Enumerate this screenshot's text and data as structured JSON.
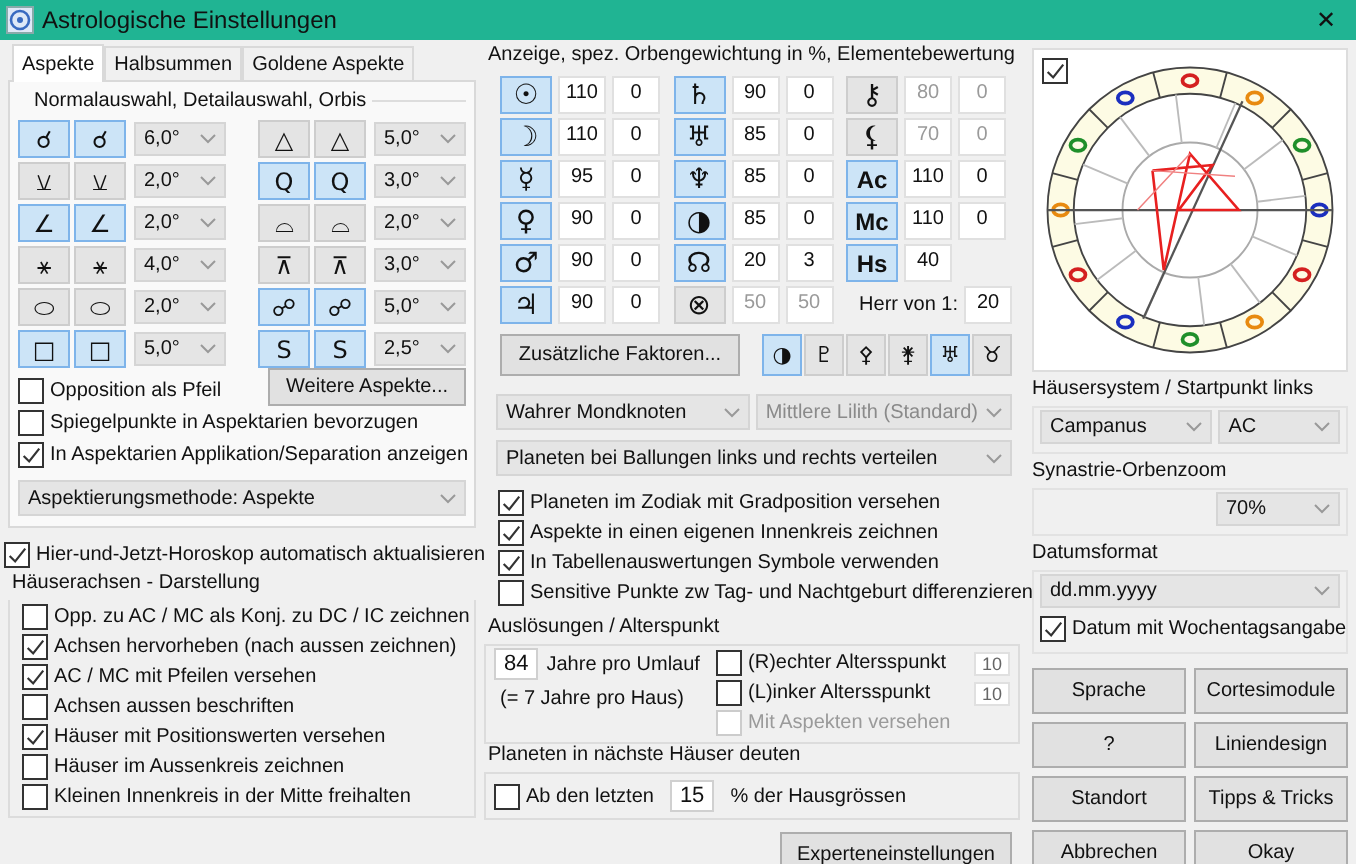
{
  "window": {
    "title": "Astrologische Einstellungen",
    "close": "✕"
  },
  "tabs": [
    {
      "label": "Aspekte",
      "selected": true
    },
    {
      "label": "Halbsummen",
      "selected": false
    },
    {
      "label": "Goldene Aspekte",
      "selected": false
    }
  ],
  "aspects": {
    "heading": "Normalauswahl, Detailauswahl, Orbis",
    "columns": [
      [
        {
          "buttons": [
            {
              "symbol": "☌",
              "selected": true
            },
            {
              "symbol": "☌",
              "selected": true
            }
          ],
          "orb": "6,0°"
        },
        {
          "buttons": [
            {
              "symbol": "⚺",
              "selected": false
            },
            {
              "symbol": "⚺",
              "selected": false
            }
          ],
          "orb": "2,0°"
        },
        {
          "buttons": [
            {
              "symbol": "∠",
              "selected": true
            },
            {
              "symbol": "∠",
              "selected": true
            }
          ],
          "orb": "2,0°"
        },
        {
          "buttons": [
            {
              "symbol": "⚹",
              "selected": false
            },
            {
              "symbol": "⚹",
              "selected": false
            }
          ],
          "orb": "4,0°"
        },
        {
          "buttons": [
            {
              "symbol": "⬭",
              "selected": false
            },
            {
              "symbol": "⬭",
              "selected": false
            }
          ],
          "orb": "2,0°"
        },
        {
          "buttons": [
            {
              "symbol": "□",
              "selected": true
            },
            {
              "symbol": "□",
              "selected": true
            }
          ],
          "orb": "5,0°"
        }
      ],
      [
        {
          "buttons": [
            {
              "symbol": "△",
              "selected": false
            },
            {
              "symbol": "△",
              "selected": false
            }
          ],
          "orb": "5,0°"
        },
        {
          "buttons": [
            {
              "symbol": "Q",
              "selected": true
            },
            {
              "symbol": "Q",
              "selected": true
            }
          ],
          "orb": "3,0°"
        },
        {
          "buttons": [
            {
              "symbol": "⌓",
              "selected": false
            },
            {
              "symbol": "⌓",
              "selected": false
            }
          ],
          "orb": "2,0°"
        },
        {
          "buttons": [
            {
              "symbol": "⊼",
              "selected": false
            },
            {
              "symbol": "⊼",
              "selected": false
            }
          ],
          "orb": "3,0°"
        },
        {
          "buttons": [
            {
              "symbol": "☍",
              "selected": true
            },
            {
              "symbol": "☍",
              "selected": true
            }
          ],
          "orb": "5,0°"
        },
        {
          "buttons": [
            {
              "symbol": "S",
              "selected": true
            },
            {
              "symbol": "S",
              "selected": true
            }
          ],
          "orb": "2,5°"
        }
      ]
    ]
  },
  "more_aspects_button": "Weitere Aspekte...",
  "aspect_options": [
    {
      "label": "Opposition als Pfeil",
      "checked": false
    },
    {
      "label": "Spiegelpunkte in Aspektarien bevorzugen",
      "checked": false
    },
    {
      "label": "In Aspektarien Applikation/Separation anzeigen",
      "checked": true
    }
  ],
  "method_dropdown": "Aspektierungsmethode: Aspekte",
  "auto_update": {
    "label": "Hier-und-Jetzt-Horoskop automatisch aktualisieren",
    "checked": true
  },
  "house_axes": {
    "title": "Häuserachsen - Darstellung",
    "options": [
      {
        "label": "Opp. zu  AC / MC als Konj. zu DC / IC zeichnen",
        "checked": false
      },
      {
        "label": "Achsen hervorheben (nach aussen zeichnen)",
        "checked": true
      },
      {
        "label": "AC / MC mit Pfeilen versehen",
        "checked": true
      },
      {
        "label": "Achsen aussen beschriften",
        "checked": false
      },
      {
        "label": "Häuser mit Positionswerten versehen",
        "checked": true
      },
      {
        "label": "Häuser im Aussenkreis zeichnen",
        "checked": false
      },
      {
        "label": "Kleinen Innenkreis in der Mitte freihalten",
        "checked": false
      }
    ]
  },
  "display": {
    "title": "Anzeige, spez. Orbengewichtung in %, Elementebewertung",
    "columns": [
      [
        {
          "symbol": "☉",
          "selected": true,
          "disabled": false,
          "weight": "110",
          "element": "0"
        },
        {
          "symbol": "☽",
          "selected": true,
          "disabled": false,
          "weight": "110",
          "element": "0"
        },
        {
          "symbol": "☿",
          "selected": true,
          "disabled": false,
          "weight": "95",
          "element": "0"
        },
        {
          "symbol": "♀",
          "selected": true,
          "disabled": false,
          "weight": "90",
          "element": "0"
        },
        {
          "symbol": "♂",
          "selected": true,
          "disabled": false,
          "weight": "90",
          "element": "0"
        },
        {
          "symbol": "♃",
          "selected": true,
          "disabled": false,
          "weight": "90",
          "element": "0"
        }
      ],
      [
        {
          "symbol": "♄",
          "selected": true,
          "disabled": false,
          "weight": "90",
          "element": "0"
        },
        {
          "symbol": "♅",
          "selected": true,
          "disabled": false,
          "weight": "85",
          "element": "0"
        },
        {
          "symbol": "♆",
          "selected": true,
          "disabled": false,
          "weight": "85",
          "element": "0"
        },
        {
          "symbol": "◑",
          "selected": true,
          "disabled": false,
          "weight": "85",
          "element": "0"
        },
        {
          "symbol": "☊",
          "selected": true,
          "disabled": false,
          "weight": "20",
          "element": "3"
        },
        {
          "symbol": "⊗",
          "selected": false,
          "disabled": true,
          "weight": "50",
          "element": "50"
        }
      ],
      [
        {
          "symbol": "⚷",
          "selected": false,
          "disabled": true,
          "weight": "80",
          "element": "0"
        },
        {
          "symbol": "⚸",
          "selected": false,
          "disabled": true,
          "weight": "70",
          "element": "0"
        },
        {
          "symbol": "Ac",
          "selected": true,
          "disabled": false,
          "weight": "110",
          "element": "0"
        },
        {
          "symbol": "Mc",
          "selected": true,
          "disabled": false,
          "weight": "110",
          "element": "0"
        },
        {
          "symbol": "Hs",
          "selected": true,
          "disabled": false,
          "weight": "40"
        }
      ]
    ],
    "lord": {
      "label": "Herr von 1:",
      "value": "20"
    }
  },
  "extra_factors_button": "Zusätzliche Faktoren...",
  "factor_toggles": [
    {
      "symbol": "◑",
      "selected": true
    },
    {
      "symbol": "♇",
      "selected": false
    },
    {
      "symbol": "⚴",
      "selected": false
    },
    {
      "symbol": "⚵",
      "selected": false
    },
    {
      "symbol": "♅",
      "selected": true
    },
    {
      "symbol": "♉",
      "selected": false
    }
  ],
  "node_dropdown": {
    "value": "Wahrer Mondknoten",
    "disabled": false
  },
  "lilith_dropdown": {
    "value": "Mittlere Lilith (Standard)",
    "disabled": true
  },
  "spread_dropdown": "Planeten bei Ballungen links und rechts verteilen",
  "chart_options": [
    {
      "label": "Planeten im Zodiak mit Gradposition versehen",
      "checked": true
    },
    {
      "label": "Aspekte in einen eigenen Innenkreis zeichnen",
      "checked": true
    },
    {
      "label": "In Tabellenauswertungen Symbole verwenden",
      "checked": true
    },
    {
      "label": "Sensitive Punkte zw Tag- und Nachtgeburt differenzieren",
      "checked": false
    }
  ],
  "progression": {
    "title": "Auslösungen / Alterspunkt",
    "years": "84",
    "years_label": "Jahre pro Umlauf",
    "per_house": "(= 7 Jahre pro Haus)",
    "points": [
      {
        "label": "(R)echter Altersspunkt",
        "checked": false,
        "disabled": false,
        "value": "10"
      },
      {
        "label": "(L)inker Altersspunkt",
        "checked": false,
        "disabled": false,
        "value": "10"
      },
      {
        "label": "Mit Aspekten versehen",
        "checked": false,
        "disabled": true
      }
    ]
  },
  "next_house": {
    "title": "Planeten in nächste Häuser deuten",
    "option": {
      "label": "Ab den letzten",
      "checked": false
    },
    "value": "15",
    "suffix": "% der Hausgrössen"
  },
  "expert_button": "Experteneinstellungen",
  "preview": {
    "checked": true
  },
  "house_system": {
    "title": "Häusersystem / Startpunkt links",
    "system": "Campanus",
    "start": "AC"
  },
  "synastry": {
    "title": "Synastrie-Orbenzoom",
    "value": "70%"
  },
  "date_format": {
    "title": "Datumsformat",
    "value": "dd.mm.yyyy",
    "weekday": {
      "label": "Datum mit Wochentagsangabe",
      "checked": true
    }
  },
  "buttons": [
    "Sprache",
    "Cortesimodule",
    "?",
    "Liniendesign",
    "Standort",
    "Tipps & Tricks",
    "Abbrechen",
    "Okay"
  ]
}
